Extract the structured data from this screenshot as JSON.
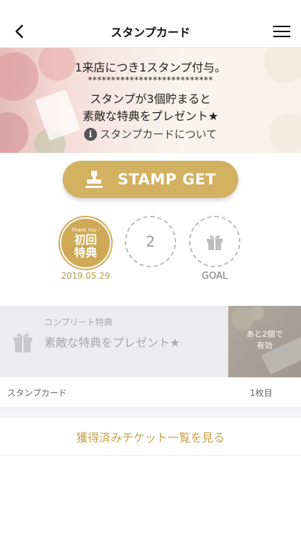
{
  "nav": {
    "title": "スタンプカード"
  },
  "hero": {
    "line1": "1来店につき1スタンプ付与。",
    "stars": "***************************",
    "line2": "スタンプが3個貯まると",
    "line3": "素敵な特典をプレゼント★",
    "about_link": "スタンプカードについて",
    "info_icon_glyph": "i"
  },
  "stamp_button": {
    "label": "STAMP GET"
  },
  "stamps": {
    "first": {
      "thank_you": "Thank You !",
      "label": "初回\n特典",
      "label_line1": "初回",
      "label_line2": "特典",
      "date": "2019.05.29"
    },
    "second": {
      "number": "2"
    },
    "goal": {
      "label": "GOAL"
    }
  },
  "complete_reward": {
    "title": "コンプリート特典",
    "text": "素敵な特典をプレゼント★",
    "badge_line1": "あと2個で",
    "badge_line2": "有効"
  },
  "card_info": {
    "label": "スタンプカード",
    "count": "1枚目"
  },
  "ticket_link": {
    "label": "獲得済みチケット一覧を見る"
  },
  "colors": {
    "gold": "#d2b160",
    "gold_text": "#c6a24c",
    "card_bg": "#ebebf0"
  }
}
